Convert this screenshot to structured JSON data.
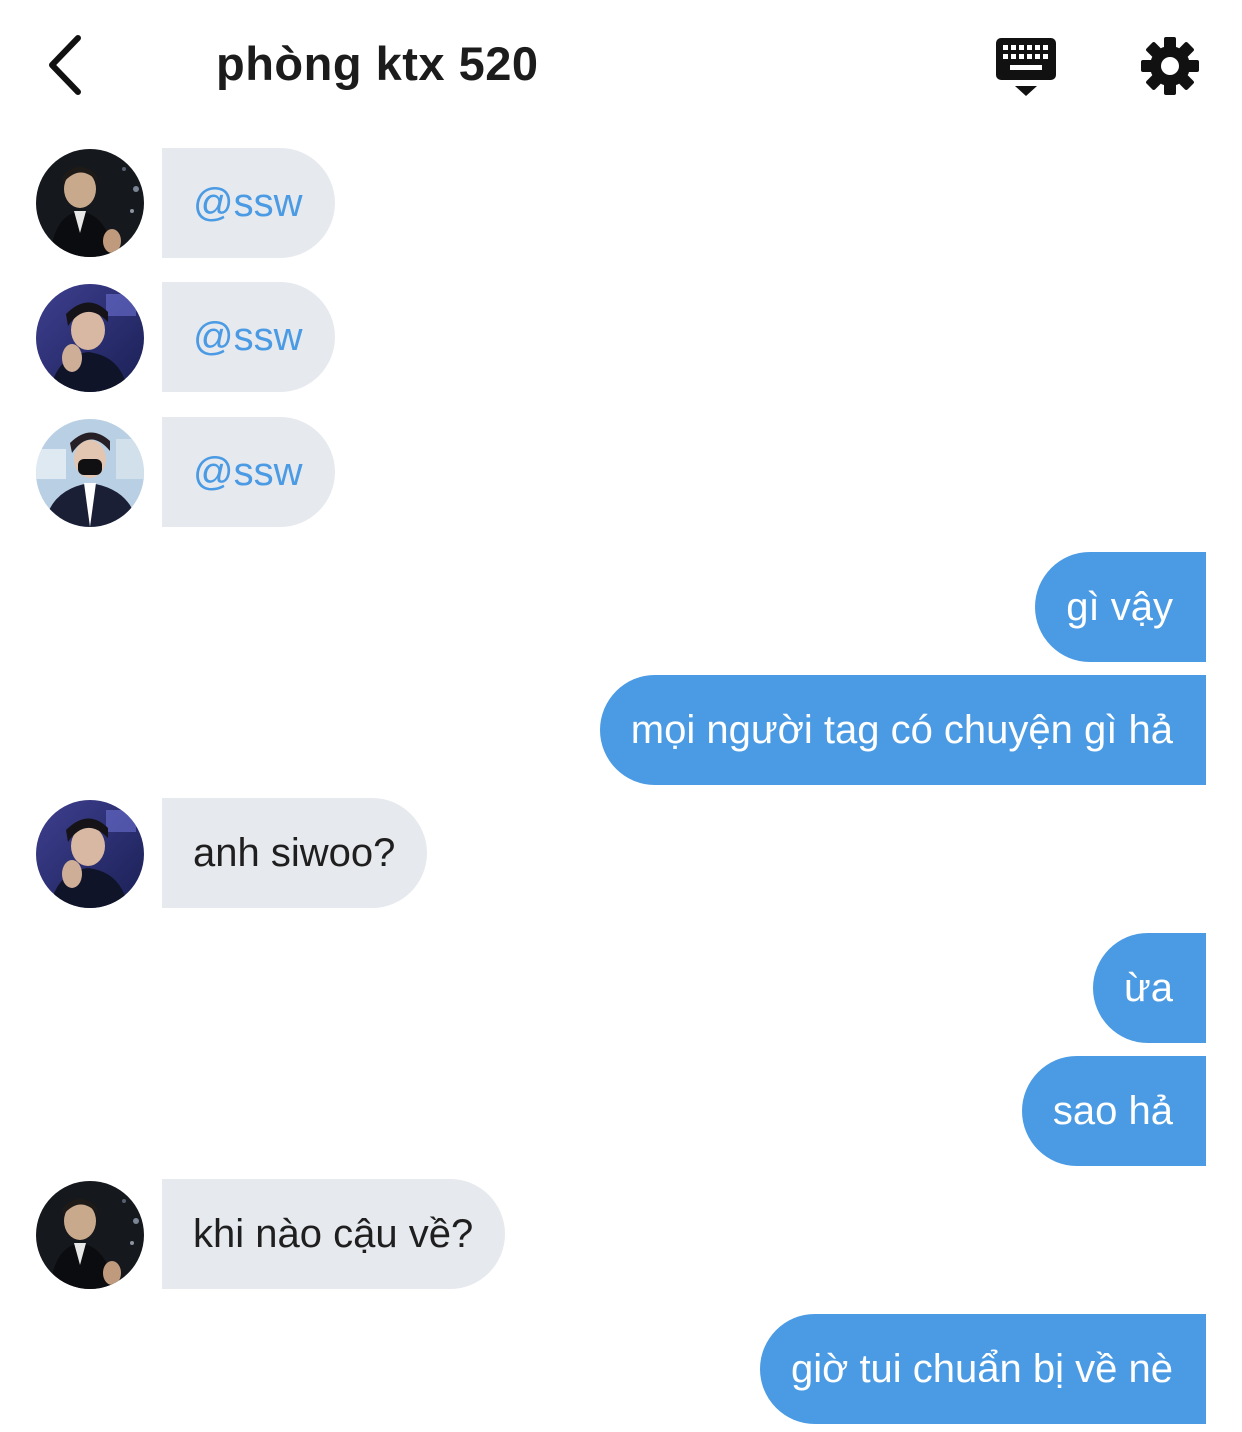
{
  "header": {
    "title": "phòng ktx 520"
  },
  "icons": {
    "back": "chevron-left-icon",
    "keyboard": "keyboard-icon",
    "settings": "gear-icon"
  },
  "colors": {
    "outgoing_bubble": "#4b9be4",
    "incoming_bubble": "#e6e9ee",
    "mention_text": "#4b9be4"
  },
  "messages": [
    {
      "direction": "incoming",
      "sender_avatar": "avatar-1",
      "text": "@ssw"
    },
    {
      "direction": "incoming",
      "sender_avatar": "avatar-2",
      "text": "@ssw"
    },
    {
      "direction": "incoming",
      "sender_avatar": "avatar-3",
      "text": "@ssw"
    },
    {
      "direction": "outgoing",
      "text": "gì vậy"
    },
    {
      "direction": "outgoing",
      "text": "mọi người tag có chuyện gì hả"
    },
    {
      "direction": "incoming",
      "sender_avatar": "avatar-2",
      "text": "anh siwoo?"
    },
    {
      "direction": "outgoing",
      "text": "ừa"
    },
    {
      "direction": "outgoing",
      "text": "sao hả"
    },
    {
      "direction": "incoming",
      "sender_avatar": "avatar-1",
      "text": "khi nào cậu về?"
    },
    {
      "direction": "outgoing",
      "text": "giờ tui chuẩn bị về nè"
    }
  ]
}
